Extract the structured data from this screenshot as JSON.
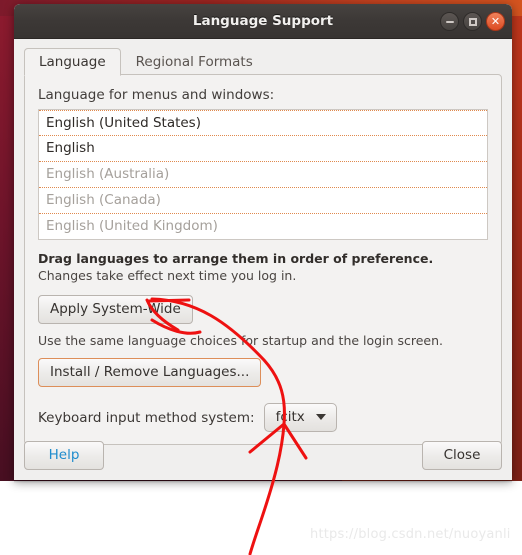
{
  "window": {
    "title": "Language Support",
    "buttons": {
      "minimize": "minimize",
      "maximize": "maximize",
      "close": "close"
    }
  },
  "tabs": [
    {
      "label": "Language",
      "active": true
    },
    {
      "label": "Regional Formats",
      "active": false
    }
  ],
  "main": {
    "list_label": "Language for menus and windows:",
    "languages": [
      {
        "label": "English (United States)",
        "muted": false
      },
      {
        "label": "English",
        "muted": false
      },
      {
        "label": "English (Australia)",
        "muted": true
      },
      {
        "label": "English (Canada)",
        "muted": true
      },
      {
        "label": "English (United Kingdom)",
        "muted": true
      }
    ],
    "drag_hint": "Drag languages to arrange them in order of preference.",
    "changes_hint": "Changes take effect next time you log in.",
    "apply_button": "Apply System-Wide",
    "apply_hint": "Use the same language choices for startup and the login screen.",
    "install_button": "Install / Remove Languages...",
    "keyboard_label": "Keyboard input method system:",
    "keyboard_value": "fcitx"
  },
  "footer": {
    "help_button": "Help",
    "close_button": "Close"
  },
  "watermark": "https://blog.csdn.net/nuoyanli",
  "colors": {
    "accent_orange": "#dd8e59",
    "link_blue": "#1f8ccd",
    "annotation_red": "#ee1111",
    "titlebar": "#3c3836",
    "window_bg": "#f0efee",
    "list_separator": "#e08a4e"
  }
}
